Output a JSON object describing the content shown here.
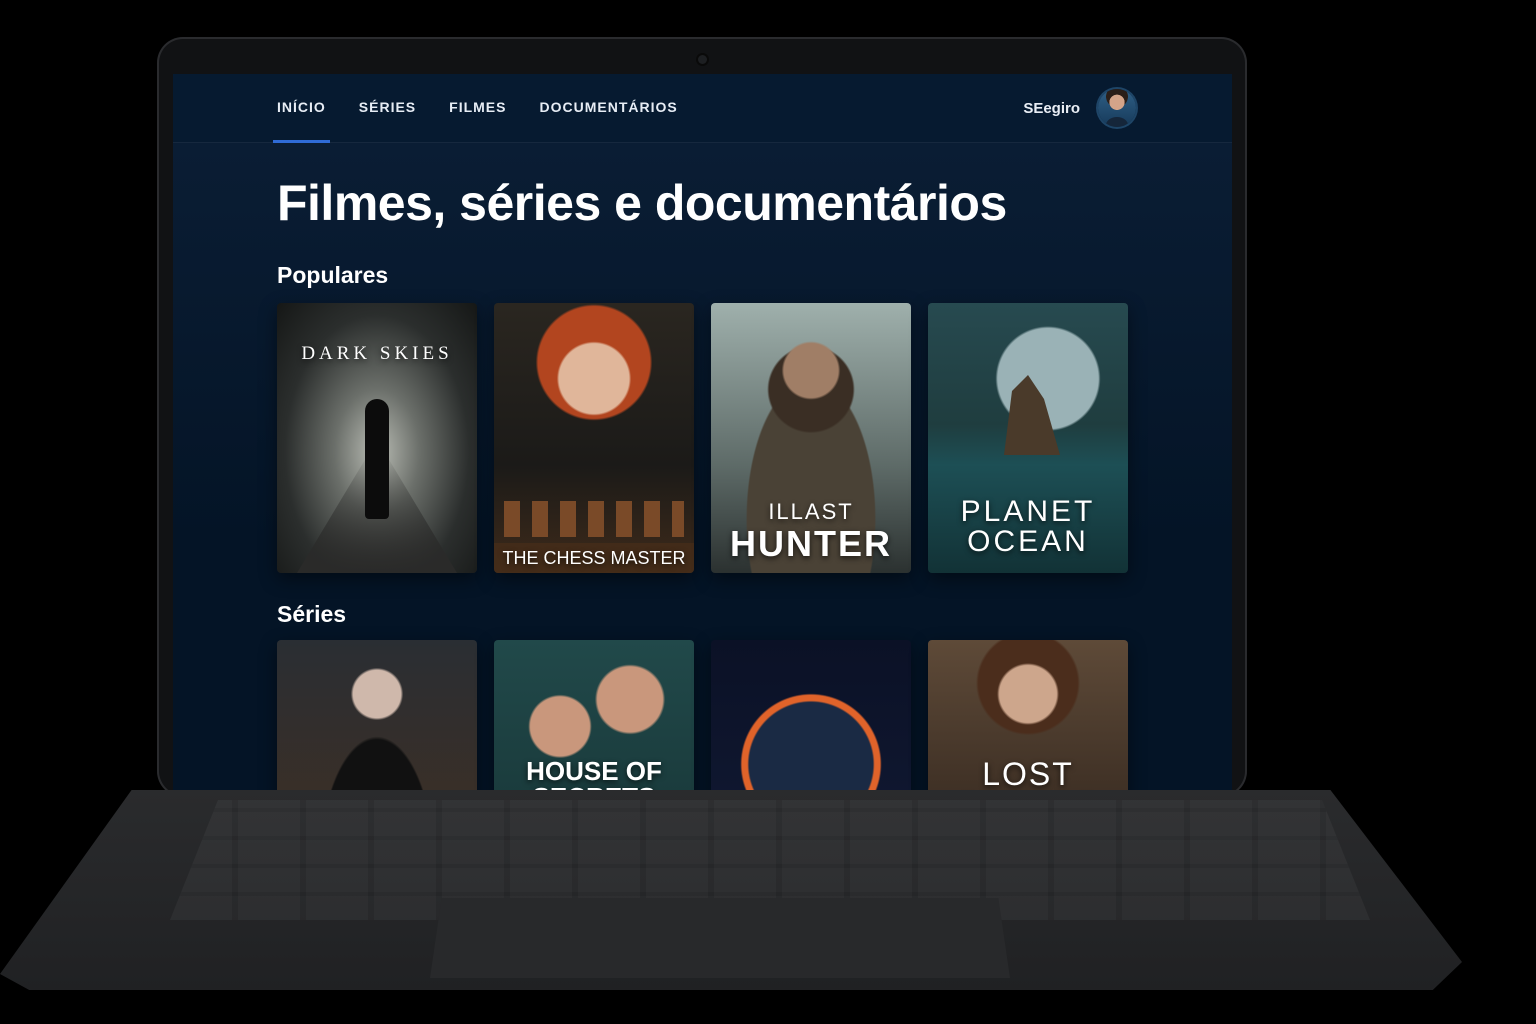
{
  "nav": {
    "items": [
      "INÍCIO",
      "SÉRIES",
      "FILMES",
      "DOCUMENTÁRIOS"
    ]
  },
  "user": {
    "name": "SEegiro"
  },
  "page_title": "Filmes, séries e documentários",
  "sections": {
    "popular": {
      "title": "Populares",
      "cards": {
        "dark_skies": {
          "label": "DARK SKIES"
        },
        "chess": {
          "label": "THE CHESS MASTER"
        },
        "hunter": {
          "label_small": "ILLAST",
          "label_big": "HUNTER"
        },
        "ocean": {
          "label_small": "PLANET",
          "label_big": "OCEAN"
        }
      }
    },
    "series": {
      "title": "Séries",
      "cards": {
        "secrets": {
          "label": "HOUSE OF SECRETS"
        },
        "lost": {
          "label": "LOST FUTURE"
        }
      }
    }
  },
  "colors": {
    "background": "#041426",
    "accent": "#2f6bd6",
    "text": "#ffffff"
  }
}
